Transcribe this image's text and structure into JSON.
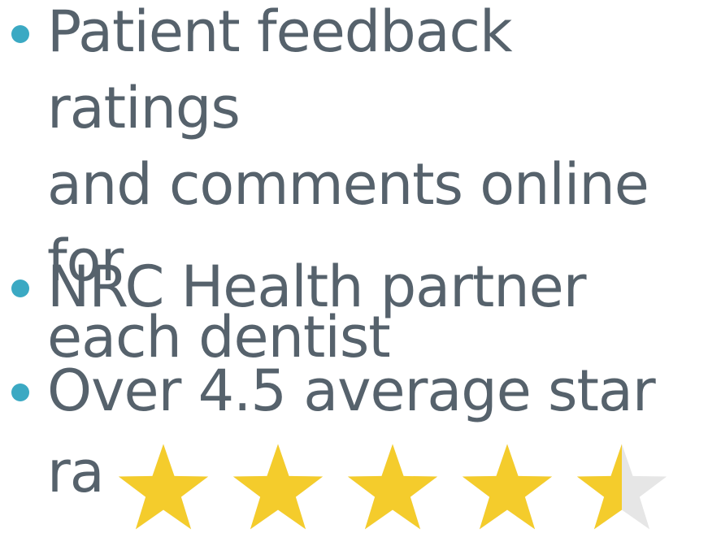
{
  "bullets": [
    {
      "text": "Patient feedback ratings\nand comments online for\neach dentist"
    },
    {
      "text": "NRC Health partner"
    },
    {
      "text": "Over 4.5 average star"
    }
  ],
  "rating": {
    "prefix": "ra",
    "stars_total": 5,
    "stars_filled": 4.5
  },
  "colors": {
    "text": "#56626c",
    "bullet": "#3ba9c3",
    "star_filled": "#f4cc2c",
    "star_empty": "#e6e6e6"
  }
}
